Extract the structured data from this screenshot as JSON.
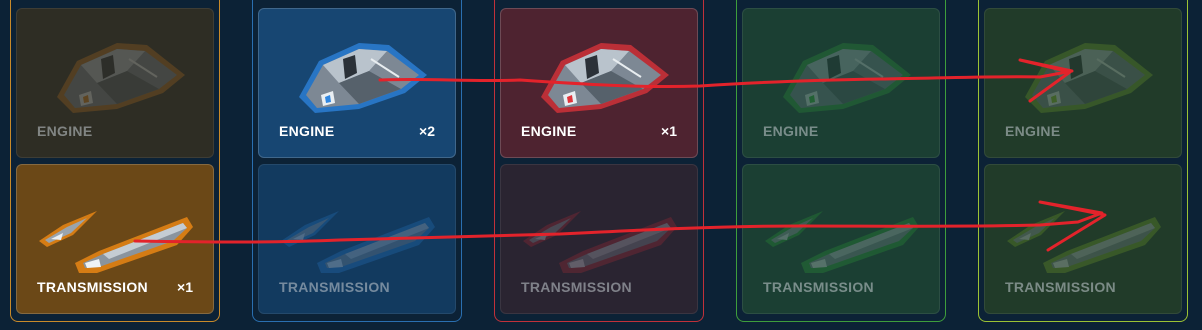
{
  "columns": [
    {
      "id": "orange",
      "border": "#c88a2a",
      "cards": [
        {
          "label": "ENGINE",
          "count": "",
          "bg": "#2e2d24",
          "active": false,
          "part": "engine",
          "color": "#d8821c"
        },
        {
          "label": "TRANSMISSION",
          "count": "×1",
          "bg": "#6b4817",
          "active": true,
          "part": "transmission",
          "color": "#f08a14"
        }
      ]
    },
    {
      "id": "blue",
      "border": "#2a6fb0",
      "cards": [
        {
          "label": "ENGINE",
          "count": "×2",
          "bg": "#174672",
          "active": true,
          "part": "engine",
          "color": "#2f86e0"
        },
        {
          "label": "TRANSMISSION",
          "count": "",
          "bg": "#123a5f",
          "active": false,
          "part": "transmission",
          "color": "#2f86e0"
        }
      ]
    },
    {
      "id": "red",
      "border": "#c0313a",
      "cards": [
        {
          "label": "ENGINE",
          "count": "×1",
          "bg": "#4e2330",
          "active": true,
          "part": "engine",
          "color": "#e0343a"
        },
        {
          "label": "TRANSMISSION",
          "count": "",
          "bg": "#2a2431",
          "active": false,
          "part": "transmission",
          "color": "#d23038"
        }
      ]
    },
    {
      "id": "green",
      "border": "#3e9e3c",
      "cards": [
        {
          "label": "ENGINE",
          "count": "",
          "bg": "#1b3f33",
          "active": false,
          "part": "engine",
          "color": "#35b83a"
        },
        {
          "label": "TRANSMISSION",
          "count": "",
          "bg": "#1b3f33",
          "active": false,
          "part": "transmission",
          "color": "#35b83a"
        }
      ]
    },
    {
      "id": "lime",
      "border": "#9cc234",
      "cards": [
        {
          "label": "ENGINE",
          "count": "",
          "bg": "#213b29",
          "active": false,
          "part": "engine",
          "color": "#8dbf2a"
        },
        {
          "label": "TRANSMISSION",
          "count": "",
          "bg": "#213b29",
          "active": false,
          "part": "transmission",
          "color": "#8dbf2a"
        }
      ]
    }
  ],
  "annotation_color": "#e3232b"
}
